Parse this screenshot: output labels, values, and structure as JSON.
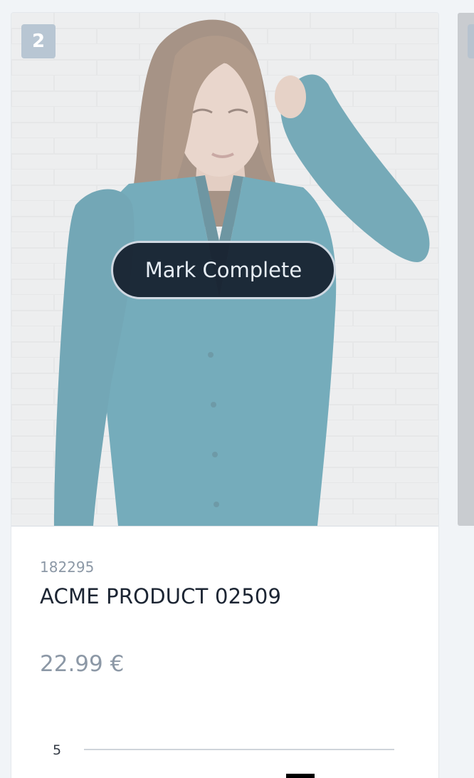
{
  "card": {
    "rank": "2",
    "image_alt": "model wearing teal cardigan",
    "action_label": "Mark Complete",
    "sku": "182295",
    "product_name": "ACME PRODUCT 02509",
    "price": "22.99 €"
  },
  "chart_data": {
    "type": "bar",
    "y_ticks": [
      "5"
    ],
    "ylim": [
      0,
      5
    ],
    "bar_color": "#000000"
  }
}
